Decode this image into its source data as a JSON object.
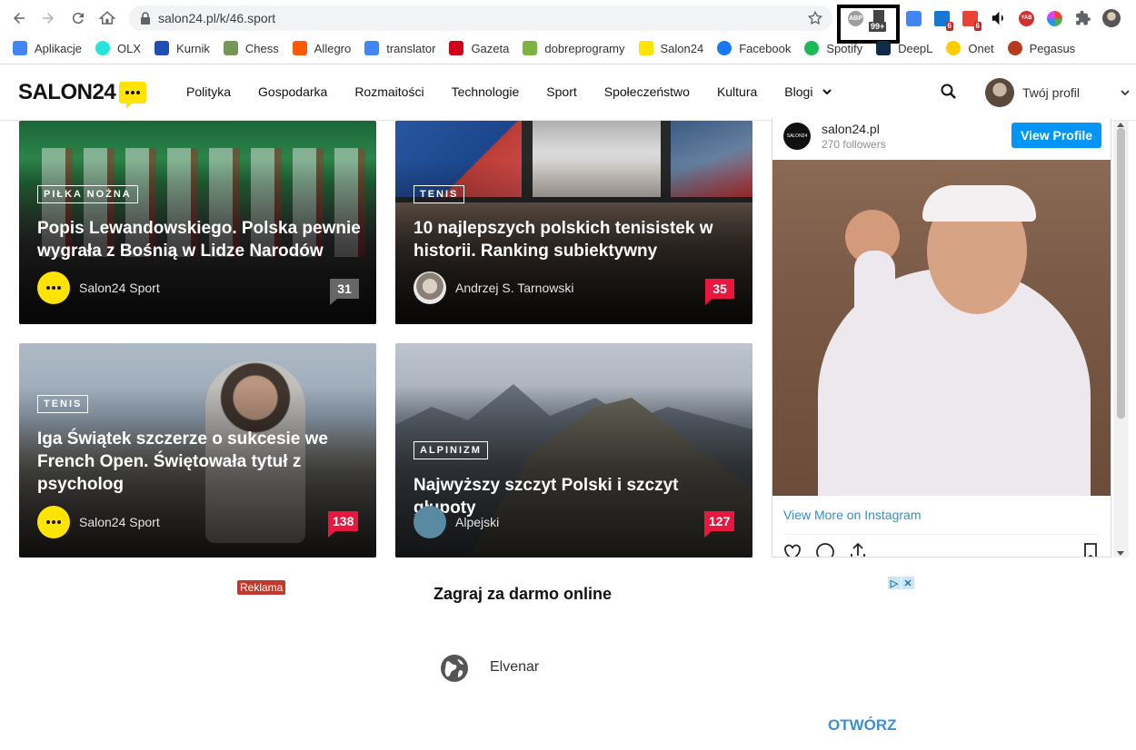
{
  "browser": {
    "url": "salon24.pl/k/46.sport",
    "extension_badge": "99+",
    "gmail_count_1": "6",
    "gmail_count_2": "6",
    "yab_label": "YAB",
    "abp_label": "ABP"
  },
  "bookmarks": [
    {
      "label": "Aplikacje",
      "icon": "apps-grid-icon",
      "color": "#4285f4"
    },
    {
      "label": "OLX",
      "icon": "olx-icon",
      "color": "#23e5db"
    },
    {
      "label": "Kurnik",
      "icon": "star-icon",
      "color": "#1e50b4"
    },
    {
      "label": "Chess",
      "icon": "pawn-icon",
      "color": "#769656"
    },
    {
      "label": "Allegro",
      "icon": "allegro-icon",
      "color": "#ff5a00"
    },
    {
      "label": "translator",
      "icon": "translate-icon",
      "color": "#4285f4"
    },
    {
      "label": "Gazeta",
      "icon": "gazeta-icon",
      "color": "#d0021b"
    },
    {
      "label": "dobreprogramy",
      "icon": "dp-icon",
      "color": "#7cb342"
    },
    {
      "label": "Salon24",
      "icon": "salon24-icon",
      "color": "#ffe400"
    },
    {
      "label": "Facebook",
      "icon": "facebook-icon",
      "color": "#1877f2"
    },
    {
      "label": "Spotify",
      "icon": "spotify-icon",
      "color": "#1db954"
    },
    {
      "label": "DeepL",
      "icon": "deepl-icon",
      "color": "#0f2b46"
    },
    {
      "label": "Onet",
      "icon": "onet-icon",
      "color": "#ffcc00"
    },
    {
      "label": "Pegasus",
      "icon": "pegasus-icon",
      "color": "#b83b1d"
    }
  ],
  "site": {
    "logo_text": "SALON24",
    "menu": [
      "Polityka",
      "Gospodarka",
      "Rozmaitości",
      "Technologie",
      "Sport",
      "Społeczeństwo",
      "Kultura",
      "Blogi"
    ],
    "profile_label": "Twój profil"
  },
  "articles": [
    {
      "tag": "PIŁKA NOŻNA",
      "title": "Popis Lewandowskiego. Polska pewnie wygrała z Bośnią w Lidze Narodów",
      "author": "Salon24 Sport",
      "comments": "31",
      "comment_style": "gray"
    },
    {
      "tag": "TENIS",
      "title": "10 najlepszych polskich tenisistek w historii. Ranking subiektywny",
      "author": "Andrzej S. Tarnowski",
      "comments": "35",
      "comment_style": "red"
    },
    {
      "tag": "TENIS",
      "title": "Iga Świątek szczerze o sukcesie we French Open. Świętowała tytuł z psycholog",
      "author": "Salon24 Sport",
      "comments": "138",
      "comment_style": "red"
    },
    {
      "tag": "ALPINIZM",
      "title": "Najwyższy szczyt Polski i szczyt głupoty",
      "author": "Alpejski",
      "comments": "127",
      "comment_style": "red"
    }
  ],
  "instagram": {
    "account": "salon24.pl",
    "followers": "270 followers",
    "view_profile": "View Profile",
    "view_more": "View More on Instagram",
    "avatar_text": "SALON24"
  },
  "ad": {
    "label": "Reklama",
    "title": "Zagraj za darmo online",
    "brand": "Elvenar",
    "cta": "OTWÓRZ"
  }
}
